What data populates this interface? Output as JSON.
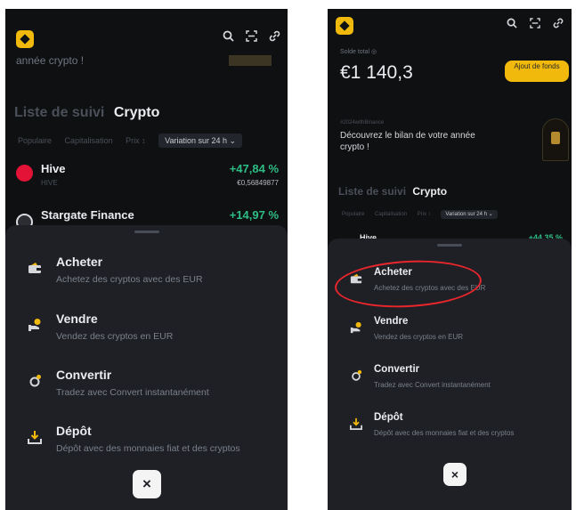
{
  "left": {
    "banner_partial": "année crypto !",
    "watchlist": {
      "tab_watch": "Liste de suivi",
      "tab_crypto": "Crypto"
    },
    "filters": [
      "Populaire",
      "Capitalisation",
      "Prix ↕"
    ],
    "filter_selected": "Variation sur 24 h ⌄",
    "coins": [
      {
        "name": "Hive",
        "ticker": "HIVE",
        "change": "+47,84 %",
        "price": "€0,56849877",
        "color": "#e31337"
      },
      {
        "name": "Stargate Finance",
        "ticker": "",
        "change": "+14,97 %",
        "price": "",
        "color": "#d9dadd"
      }
    ],
    "close_label": "×"
  },
  "right": {
    "balance_label": "Solde total ◎",
    "balance": "€1 140,3",
    "add_funds": "Ajout de fonds",
    "hashtag": "#2024withBinance",
    "promo": "Découvrez le bilan de votre année crypto !",
    "watchlist": {
      "tab_watch": "Liste de suivi",
      "tab_crypto": "Crypto"
    },
    "filters": [
      "Populaire",
      "Capitalisation",
      "Prix ↕"
    ],
    "filter_selected": "Variation sur 24 h ⌄",
    "coins": [
      {
        "name": "Hive",
        "change": "+44,35 %"
      }
    ],
    "close_label": "×"
  },
  "actions": [
    {
      "id": "buy",
      "icon": "wallet-icon",
      "title": "Acheter",
      "subtitle": "Achetez des cryptos avec des EUR"
    },
    {
      "id": "sell",
      "icon": "sell-coin-icon",
      "title": "Vendre",
      "subtitle": "Vendez des cryptos en EUR"
    },
    {
      "id": "convert",
      "icon": "convert-icon",
      "title": "Convertir",
      "subtitle": "Tradez avec Convert instantanément"
    },
    {
      "id": "deposit",
      "icon": "deposit-icon",
      "title": "Dépôt",
      "subtitle": "Dépôt avec des monnaies fiat et des cryptos"
    }
  ],
  "top_icons": [
    "search-icon",
    "scan-icon",
    "link-icon"
  ],
  "colors": {
    "background": "#0f1012",
    "sheet": "#1e2026",
    "accent_yellow": "#f0b90b",
    "positive_green": "#2ebd85",
    "annotation_red": "#e8262c"
  }
}
